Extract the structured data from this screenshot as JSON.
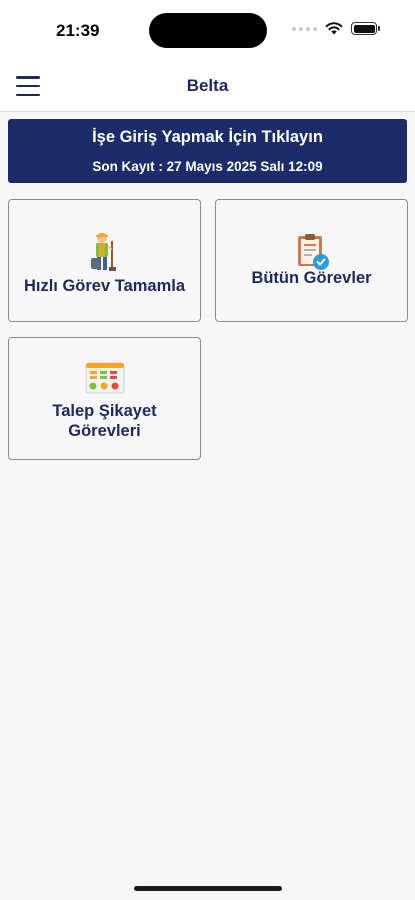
{
  "status_bar": {
    "time": "21:39"
  },
  "header": {
    "title": "Belta"
  },
  "checkin": {
    "title": "İşe Giriş Yapmak İçin Tıklayın",
    "last_record": "Son Kayıt : 27 Mayıs 2025 Salı 12:09"
  },
  "cards": [
    {
      "label": "Hızlı Görev Tamamla",
      "icon": "worker-icon"
    },
    {
      "label": "Bütün Görevler",
      "icon": "clipboard-check-icon"
    },
    {
      "label_line1": "Talep Şikayet",
      "label_line2": "Görevleri",
      "icon": "feedback-icon"
    }
  ]
}
